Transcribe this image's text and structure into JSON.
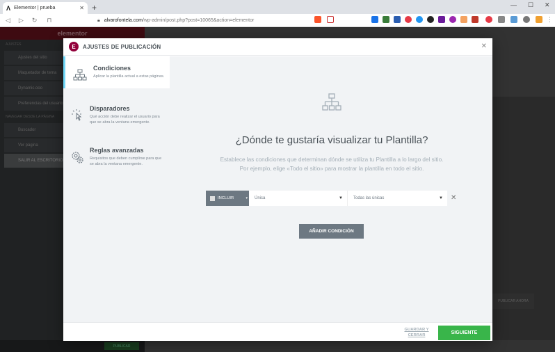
{
  "browser": {
    "tab_title": "Elementor | prueba",
    "url_host": "alvarofontela.com",
    "url_path": "/wp-admin/post.php?post=10065&action=elementor"
  },
  "editor_bg": {
    "panel_logo": "elementor",
    "items": [
      "Ajustes del sitio",
      "Maquetador de tema",
      "Dynamic.ooo",
      "Preferencias del usuario",
      "Buscador",
      "Ver página",
      "SALIR AL ESCRITORIO"
    ],
    "section_labels": [
      "AJUSTES",
      "NAVEGAR DESDE LA PÁGINA"
    ],
    "publish_label": "PUBLICAR",
    "right_label": "PUBLICAR AHORA"
  },
  "modal": {
    "title": "AJUSTES DE PUBLICACIÓN",
    "logo_letter": "E",
    "nav": [
      {
        "title": "Condiciones",
        "desc": "Aplicar la plantilla actual a estas páginas.",
        "icon": "sitemap-icon"
      },
      {
        "title": "Disparadores",
        "desc": "Qué acción debe realizar el usuario para que se abra la ventana emergente.",
        "icon": "pointer-click-icon"
      },
      {
        "title": "Reglas avanzadas",
        "desc": "Requisitos que deben cumplirse para que se abra la ventana emergente.",
        "icon": "gears-icon"
      }
    ],
    "heading": "¿Dónde te gustaría visualizar tu Plantilla?",
    "desc_line1": "Establece las condiciones que determinan dónde se utiliza tu Plantilla a lo largo del sitio.",
    "desc_line2": "Por ejemplo, elige «Todo el sitio» para mostrar la plantilla en todo el sitio.",
    "condition": {
      "include_label": "INCLUIR",
      "type_value": "Única",
      "sub_value": "Todas las únicas"
    },
    "add_button": "AÑADIR CONDICIÓN",
    "save_draft": "GUARDAR Y CERRAR",
    "next_button": "SIGUIENTE"
  },
  "colors": {
    "accent": "#92003b",
    "success": "#39b54a",
    "active_border": "#71d7f7"
  }
}
